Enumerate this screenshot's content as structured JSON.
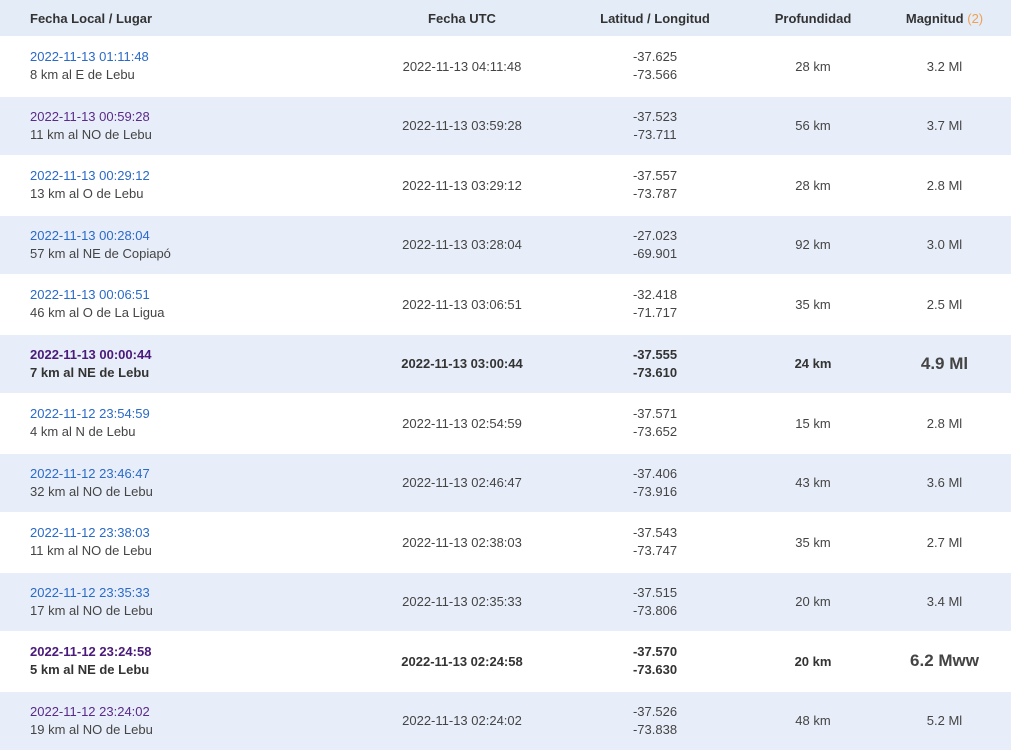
{
  "headers": {
    "place": "Fecha Local / Lugar",
    "utc": "Fecha UTC",
    "coords": "Latitud / Longitud",
    "depth": "Profundidad",
    "magnitude": "Magnitud",
    "magnitude_count": "(2)"
  },
  "rows": [
    {
      "local": "2022-11-13 01:11:48",
      "ref": "8 km al E de Lebu",
      "utc": "2022-11-13 04:11:48",
      "lat": "-37.625",
      "lon": "-73.566",
      "depth": "28 km",
      "mag": "3.2 Ml",
      "important": false,
      "visited": false
    },
    {
      "local": "2022-11-13 00:59:28",
      "ref": "11 km al NO de Lebu",
      "utc": "2022-11-13 03:59:28",
      "lat": "-37.523",
      "lon": "-73.711",
      "depth": "56 km",
      "mag": "3.7 Ml",
      "important": false,
      "visited": true
    },
    {
      "local": "2022-11-13 00:29:12",
      "ref": "13 km al O de Lebu",
      "utc": "2022-11-13 03:29:12",
      "lat": "-37.557",
      "lon": "-73.787",
      "depth": "28 km",
      "mag": "2.8 Ml",
      "important": false,
      "visited": false
    },
    {
      "local": "2022-11-13 00:28:04",
      "ref": "57 km al NE de Copiapó",
      "utc": "2022-11-13 03:28:04",
      "lat": "-27.023",
      "lon": "-69.901",
      "depth": "92 km",
      "mag": "3.0 Ml",
      "important": false,
      "visited": false
    },
    {
      "local": "2022-11-13 00:06:51",
      "ref": "46 km al O de La Ligua",
      "utc": "2022-11-13 03:06:51",
      "lat": "-32.418",
      "lon": "-71.717",
      "depth": "35 km",
      "mag": "2.5 Ml",
      "important": false,
      "visited": false
    },
    {
      "local": "2022-11-13 00:00:44",
      "ref": "7 km al NE de Lebu",
      "utc": "2022-11-13 03:00:44",
      "lat": "-37.555",
      "lon": "-73.610",
      "depth": "24 km",
      "mag": "4.9 Ml",
      "important": true,
      "visited": true
    },
    {
      "local": "2022-11-12 23:54:59",
      "ref": "4 km al N de Lebu",
      "utc": "2022-11-13 02:54:59",
      "lat": "-37.571",
      "lon": "-73.652",
      "depth": "15 km",
      "mag": "2.8 Ml",
      "important": false,
      "visited": false
    },
    {
      "local": "2022-11-12 23:46:47",
      "ref": "32 km al NO de Lebu",
      "utc": "2022-11-13 02:46:47",
      "lat": "-37.406",
      "lon": "-73.916",
      "depth": "43 km",
      "mag": "3.6 Ml",
      "important": false,
      "visited": false
    },
    {
      "local": "2022-11-12 23:38:03",
      "ref": "11 km al NO de Lebu",
      "utc": "2022-11-13 02:38:03",
      "lat": "-37.543",
      "lon": "-73.747",
      "depth": "35 km",
      "mag": "2.7 Ml",
      "important": false,
      "visited": false
    },
    {
      "local": "2022-11-12 23:35:33",
      "ref": "17 km al NO de Lebu",
      "utc": "2022-11-13 02:35:33",
      "lat": "-37.515",
      "lon": "-73.806",
      "depth": "20 km",
      "mag": "3.4 Ml",
      "important": false,
      "visited": false
    },
    {
      "local": "2022-11-12 23:24:58",
      "ref": "5 km al NE de Lebu",
      "utc": "2022-11-13 02:24:58",
      "lat": "-37.570",
      "lon": "-73.630",
      "depth": "20 km",
      "mag": "6.2 Mww",
      "important": true,
      "visited": true
    },
    {
      "local": "2022-11-12 23:24:02",
      "ref": "19 km al NO de Lebu",
      "utc": "2022-11-13 02:24:02",
      "lat": "-37.526",
      "lon": "-73.838",
      "depth": "48 km",
      "mag": "5.2 Ml",
      "important": false,
      "visited": true
    }
  ]
}
